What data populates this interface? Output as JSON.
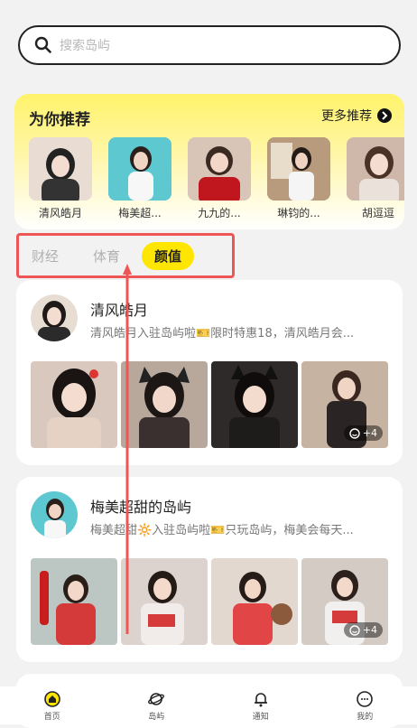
{
  "search": {
    "placeholder": "搜索岛屿"
  },
  "recommend": {
    "title": "为你推荐",
    "more": "更多推荐",
    "items": [
      {
        "name": "清风皓月"
      },
      {
        "name": "梅美超..."
      },
      {
        "name": "九九的..."
      },
      {
        "name": "琳钧的..."
      },
      {
        "name": "胡逗逗"
      }
    ]
  },
  "tabs": [
    "财经",
    "体育",
    "颜值"
  ],
  "active_tab": "颜值",
  "cards": [
    {
      "title": "清风皓月",
      "subtitle": "清风皓月入驻岛屿啦🎫限时特惠18，清风皓月会...",
      "more_count": "+4"
    },
    {
      "title": "梅美超甜的岛屿",
      "subtitle": "梅美超甜🔆入驻岛屿啦🎫只玩岛屿，梅美会每天...",
      "more_count": "+4"
    }
  ],
  "tabbar": [
    "首页",
    "岛屿",
    "通知",
    "我的"
  ],
  "colors": {
    "accent": "#ffe600",
    "highlight_box": "#e55"
  }
}
